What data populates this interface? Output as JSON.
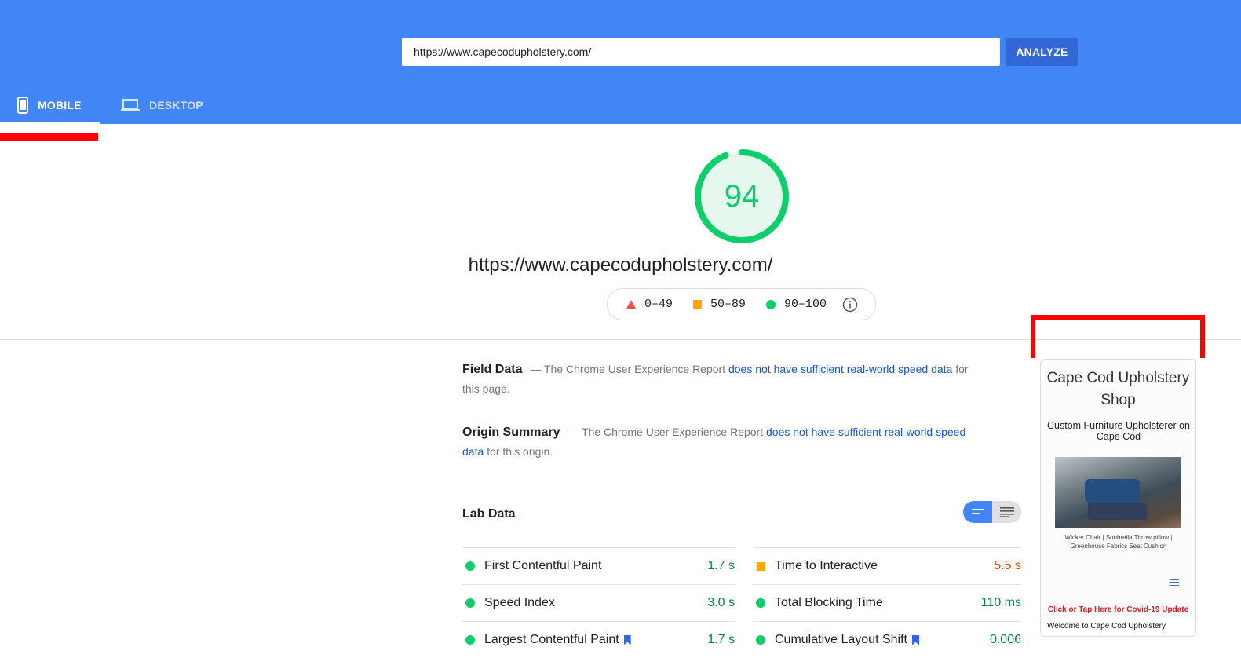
{
  "header": {
    "url_value": "https://www.capecodupholstery.com/",
    "analyze_label": "ANALYZE",
    "tabs": [
      {
        "label": "MOBILE",
        "icon": "phone-icon",
        "active": true
      },
      {
        "label": "DESKTOP",
        "icon": "laptop-icon",
        "active": false
      }
    ]
  },
  "summary": {
    "score": "94",
    "score_fraction": 0.94,
    "url": "https://www.capecodupholstery.com/",
    "legend": [
      {
        "label": "0–49",
        "icon": "triangle-icon",
        "color": "#ff4e42"
      },
      {
        "label": "50–89",
        "icon": "square-icon",
        "color": "#ffa400"
      },
      {
        "label": "90–100",
        "icon": "circle-icon",
        "color": "#0cce6b"
      }
    ]
  },
  "field_data": {
    "title": "Field Data",
    "text_before": "— The Chrome User Experience Report ",
    "link": "does not have sufficient real-world speed data",
    "text_after": " for this page."
  },
  "origin_summary": {
    "title": "Origin Summary",
    "text_before": "— The Chrome User Experience Report ",
    "link": "does not have sufficient real-world speed data",
    "text_after": " for this origin."
  },
  "lab_data": {
    "title": "Lab Data",
    "left": [
      {
        "name": "First Contentful Paint",
        "value": "1.7 s",
        "status": "pass",
        "bookmark": false
      },
      {
        "name": "Speed Index",
        "value": "3.0 s",
        "status": "pass",
        "bookmark": false
      },
      {
        "name": "Largest Contentful Paint",
        "value": "1.7 s",
        "status": "pass",
        "bookmark": true
      }
    ],
    "right": [
      {
        "name": "Time to Interactive",
        "value": "5.5 s",
        "status": "average",
        "bookmark": false
      },
      {
        "name": "Total Blocking Time",
        "value": "110 ms",
        "status": "pass",
        "bookmark": false
      },
      {
        "name": "Cumulative Layout Shift",
        "value": "0.006",
        "status": "pass",
        "bookmark": true
      }
    ]
  },
  "colors": {
    "pass": "#0cce6b",
    "pass_text": "#018642",
    "average": "#ffa400",
    "average_text": "#d04900",
    "header": "#4285f4",
    "annotation": "#ff0000"
  },
  "screenshot": {
    "site_title": "Cape Cod Upholstery Shop",
    "subtitle": "Custom Furniture Upholsterer on Cape Cod",
    "caption": "Wicker Chair | Sunbrella Throw pillow | Greenhouse Fabrics Seat Cushion",
    "covid_link": "Click or Tap Here for Covid-19 Update",
    "welcome": "Welcome to Cape Cod Upholstery"
  }
}
